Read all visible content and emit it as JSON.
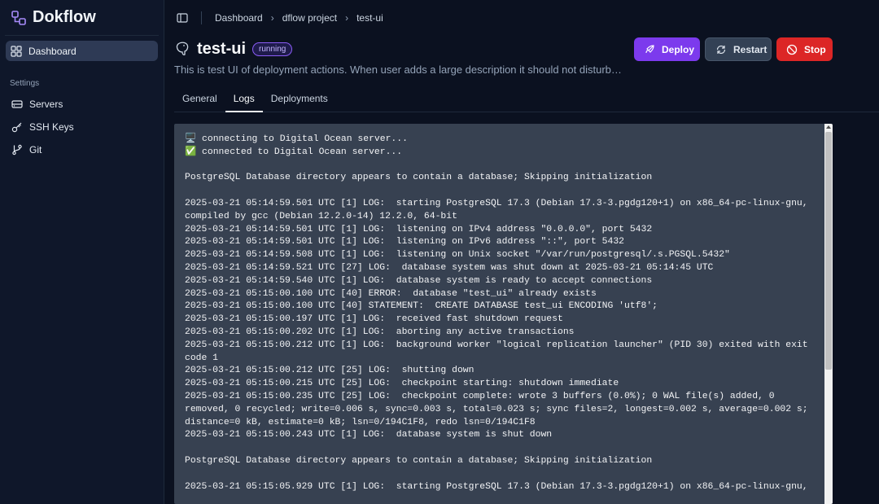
{
  "app": {
    "name": "Dokflow"
  },
  "sidebar": {
    "dashboard_label": "Dashboard",
    "settings_label": "Settings",
    "items": [
      {
        "label": "Servers",
        "icon": "server-icon"
      },
      {
        "label": "SSH Keys",
        "icon": "key-icon"
      },
      {
        "label": "Git",
        "icon": "git-branch-icon"
      }
    ]
  },
  "breadcrumb": {
    "items": [
      "Dashboard",
      "dflow project",
      "test-ui"
    ]
  },
  "service": {
    "name": "test-ui",
    "status": "running",
    "description": "This is test UI of deployment actions. When user adds a large description it should not disturb…",
    "icon": "postgres-elephant-icon"
  },
  "actions": {
    "deploy_label": "Deploy",
    "restart_label": "Restart",
    "stop_label": "Stop"
  },
  "tabs": [
    "General",
    "Logs",
    "Deployments"
  ],
  "active_tab": "Logs",
  "colors": {
    "accent": "#7c3aed",
    "danger": "#dc2626",
    "background": "#0b1120",
    "log_background": "#374151"
  },
  "logs": [
    "🖥️ connecting to Digital Ocean server...",
    "✅ connected to Digital Ocean server...",
    "",
    "PostgreSQL Database directory appears to contain a database; Skipping initialization",
    "",
    "2025-03-21 05:14:59.501 UTC [1] LOG:  starting PostgreSQL 17.3 (Debian 17.3-3.pgdg120+1) on x86_64-pc-linux-gnu, compiled by gcc (Debian 12.2.0-14) 12.2.0, 64-bit",
    "2025-03-21 05:14:59.501 UTC [1] LOG:  listening on IPv4 address \"0.0.0.0\", port 5432",
    "2025-03-21 05:14:59.501 UTC [1] LOG:  listening on IPv6 address \"::\", port 5432",
    "2025-03-21 05:14:59.508 UTC [1] LOG:  listening on Unix socket \"/var/run/postgresql/.s.PGSQL.5432\"",
    "2025-03-21 05:14:59.521 UTC [27] LOG:  database system was shut down at 2025-03-21 05:14:45 UTC",
    "2025-03-21 05:14:59.540 UTC [1] LOG:  database system is ready to accept connections",
    "2025-03-21 05:15:00.100 UTC [40] ERROR:  database \"test_ui\" already exists",
    "2025-03-21 05:15:00.100 UTC [40] STATEMENT:  CREATE DATABASE test_ui ENCODING 'utf8';",
    "2025-03-21 05:15:00.197 UTC [1] LOG:  received fast shutdown request",
    "2025-03-21 05:15:00.202 UTC [1] LOG:  aborting any active transactions",
    "2025-03-21 05:15:00.212 UTC [1] LOG:  background worker \"logical replication launcher\" (PID 30) exited with exit code 1",
    "2025-03-21 05:15:00.212 UTC [25] LOG:  shutting down",
    "2025-03-21 05:15:00.215 UTC [25] LOG:  checkpoint starting: shutdown immediate",
    "2025-03-21 05:15:00.235 UTC [25] LOG:  checkpoint complete: wrote 3 buffers (0.0%); 0 WAL file(s) added, 0 removed, 0 recycled; write=0.006 s, sync=0.003 s, total=0.023 s; sync files=2, longest=0.002 s, average=0.002 s; distance=0 kB, estimate=0 kB; lsn=0/194C1F8, redo lsn=0/194C1F8",
    "2025-03-21 05:15:00.243 UTC [1] LOG:  database system is shut down",
    "",
    "PostgreSQL Database directory appears to contain a database; Skipping initialization",
    "",
    "2025-03-21 05:15:05.929 UTC [1] LOG:  starting PostgreSQL 17.3 (Debian 17.3-3.pgdg120+1) on x86_64-pc-linux-gnu,"
  ]
}
